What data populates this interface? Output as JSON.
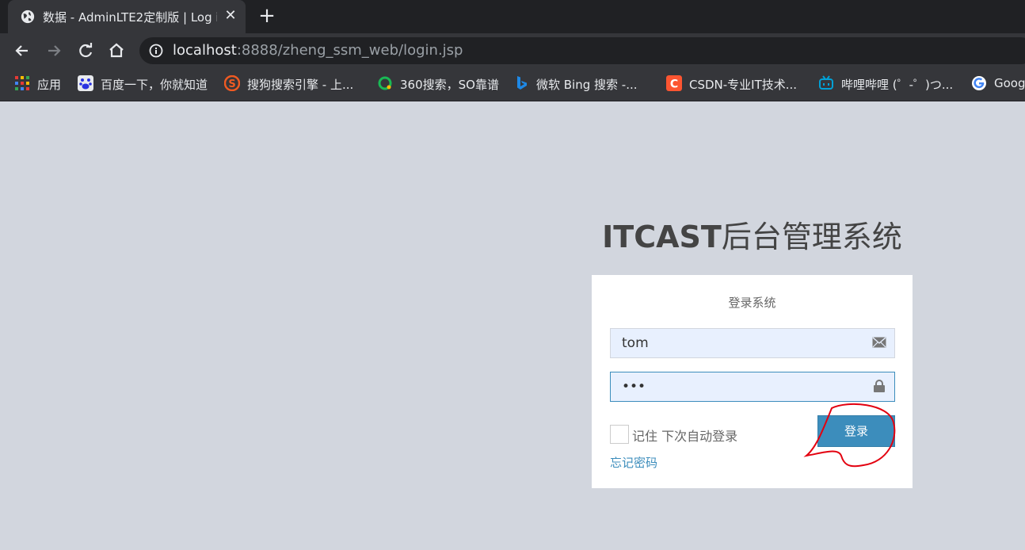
{
  "browser": {
    "tab_title": "数据 - AdminLTE2定制版 | Log i",
    "tab_close": "✕",
    "new_tab": "+",
    "url_host": "localhost",
    "url_rest": ":8888/zheng_ssm_web/login.jsp"
  },
  "bookmarks": [
    {
      "label": "应用",
      "color": "#e53935"
    },
    {
      "label": "百度一下，你就知道",
      "color": "#2932e1"
    },
    {
      "label": "搜狗搜索引擎 - 上...",
      "color": "#f05a22"
    },
    {
      "label": "360搜索，SO靠谱",
      "color": "#19b955"
    },
    {
      "label": "微软 Bing 搜索 -...",
      "color": "#1e88e5"
    },
    {
      "label": "CSDN-专业IT技术...",
      "color": "#fc5531"
    },
    {
      "label": "哔哩哔哩 (゜-゜)つ...",
      "color": "#00a1d6"
    },
    {
      "label": "Goog",
      "color": "#ffffff"
    }
  ],
  "login": {
    "logo_bold": "ITCAST",
    "logo_rest": "后台管理系统",
    "message": "登录系统",
    "username_value": "tom",
    "password_value": "•••",
    "remember_label": "记住 下次自动登录",
    "submit_label": "登录",
    "forgot_label": "忘记密码"
  },
  "colors": {
    "page_bg": "#d2d6de",
    "primary": "#3c8dbc",
    "annotation": "#e3000f"
  }
}
